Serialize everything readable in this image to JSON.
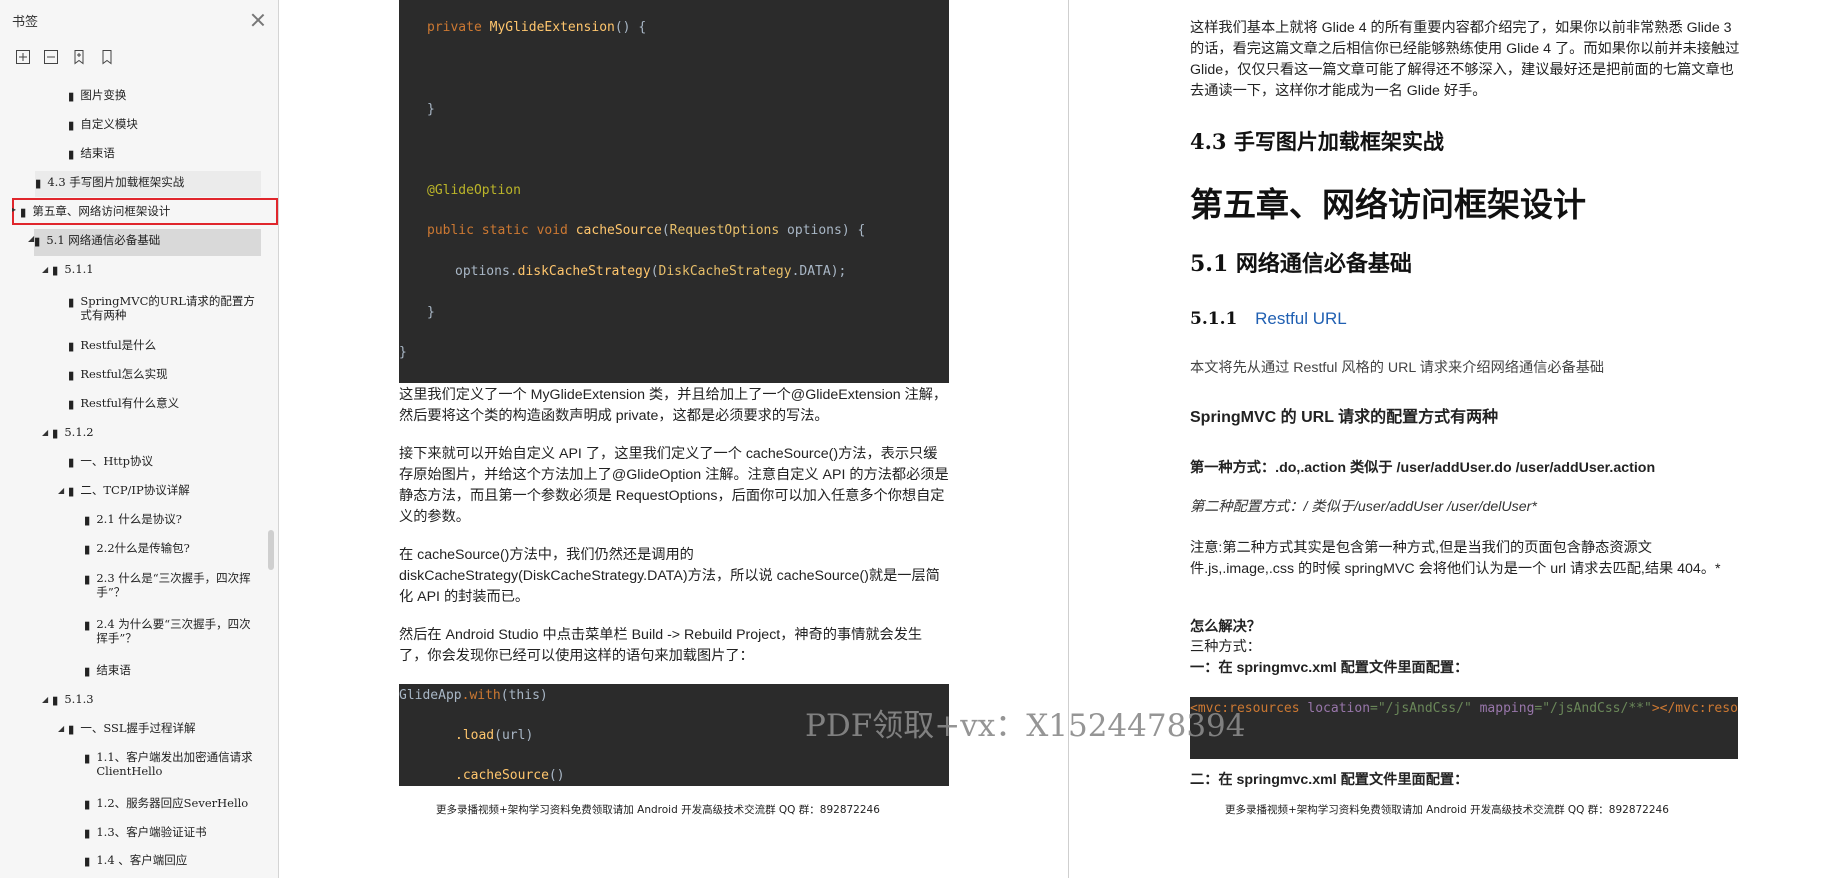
{
  "sidebar": {
    "title": "书签",
    "tools": [
      "expand-all-icon",
      "collapse-all-icon",
      "bookmark-add-icon",
      "bookmark-icon"
    ],
    "items": [
      {
        "label": "图片变换"
      },
      {
        "label": "自定义模块"
      },
      {
        "label": "结束语"
      },
      {
        "label": "4.3 手写图片加载框架实战"
      },
      {
        "label": "第五章、网络访问框架设计"
      },
      {
        "label": "5.1 网络通信必备基础"
      },
      {
        "label": "5.1.1"
      },
      {
        "label": "SpringMVC的URL请求的配置方式有两种"
      },
      {
        "label": "Restful是什么"
      },
      {
        "label": "Restful怎么实现"
      },
      {
        "label": "Restful有什么意义"
      },
      {
        "label": "5.1.2"
      },
      {
        "label": "一、Http协议"
      },
      {
        "label": "二、TCP/IP协议详解"
      },
      {
        "label": "2.1 什么是协议?"
      },
      {
        "label": "2.2什么是传输包?"
      },
      {
        "label": "2.3 什么是“三次握手，四次挥手”？"
      },
      {
        "label": "2.4 为什么要“三次握手，四次挥手”？"
      },
      {
        "label": "结束语"
      },
      {
        "label": "5.1.3"
      },
      {
        "label": "一、SSL握手过程详解"
      },
      {
        "label": "1.1、客户端发出加密通信请求ClientHello"
      },
      {
        "label": "1.2、服务器回应SeverHello"
      },
      {
        "label": "1.3、客户端验证证书"
      },
      {
        "label": "1.4 、客户端回应"
      }
    ]
  },
  "left_page": {
    "code1": {
      "private_kw": "private",
      "ctor": "MyGlideExtension",
      "ctor_tail": "() {",
      "brace1": "}",
      "annotation": "@GlideOption",
      "public_kw": "public static void",
      "method": "cacheSource",
      "param_type": "RequestOptions",
      "param_tail": " options) {",
      "body_obj": "options.",
      "body_fn": "diskCacheStrategy",
      "body_cls": "DiskCacheStrategy",
      "body_tail": ".DATA);",
      "brace2": "}",
      "brace3": "}"
    },
    "p1": "这里我们定义了一个 MyGlideExtension 类，并且给加上了一个@GlideExtension 注解，然后要将这个类的构造函数声明成 private，这都是必须要求的写法。",
    "p2": "接下来就可以开始自定义 API 了，这里我们定义了一个 cacheSource()方法，表示只缓存原始图片，并给这个方法加上了@GlideOption 注解。注意自定义 API 的方法都必须是静态方法，而且第一个参数必须是 RequestOptions，后面你可以加入任意多个你想自定义的参数。",
    "p3": "在 cacheSource()方法中，我们仍然还是调用的 diskCacheStrategy(DiskCacheStrategy.DATA)方法，所以说 cacheSource()就是一层简化 API 的封装而已。",
    "p4": "然后在 Android Studio 中点击菜单栏 Build -> Rebuild Project，神奇的事情就会发生了，你会发现你已经可以使用这样的语句来加载图片了：",
    "code2": {
      "l1_cls": "GlideApp",
      "l1_fn": ".with",
      "l1_tail": "(this)",
      "l2_fn": ".load",
      "l2_tail": "(url)",
      "l3_fn": ".cacheSource",
      "l3_tail": "()"
    },
    "footer": "更多录播视频+架构学习资料免费领取请加 Android 开发高级技术交流群 QQ 群：892872246"
  },
  "right_page": {
    "p_top": "这样我们基本上就将 Glide 4 的所有重要内容都介绍完了，如果你以前非常熟悉 Glide 3 的话，看完这篇文章之后相信你已经能够熟练使用 Glide 4 了。而如果你以前并未接触过 Glide，仅仅只看这一篇文章可能了解得还不够深入，建议最好还是把前面的七篇文章也去通读一下，这样你才能成为一名 Glide 好手。",
    "h43": "4.3 手写图片加载框架实战",
    "h5": "第五章、网络访问框架设计",
    "h51": "5.1 网络通信必备基础",
    "h511_num": "5.1.1",
    "h511_title": "Restful URL",
    "intro": "本文将先从通过 Restful 风格的 URL 请求来介绍网络通信必备基础",
    "h_spring": "SpringMVC 的 URL 请求的配置方式有两种",
    "way1": "第一种方式：.do,.action  类似于  /user/addUser.do /user/addUser.action",
    "way2": "第二种配置方式：/  类似于/user/addUser /user/delUser*",
    "note": "注意:第二种方式其实是包含第一种方式,但是当我们的页面包含静态资源文件.js,.image,.css  的时候  springMVC  会将他们认为是一个  url  请求去匹配,结果 404。*",
    "how": "怎么解决？",
    "three": "三种方式：",
    "one": "一：在 springmvc.xml 配置文件里面配置：",
    "xml_tag": "<mvc:resources",
    "xml_attr1": " location",
    "xml_val1": "=\"/jsAndCss/\"",
    "xml_attr2": " mapping",
    "xml_val2": "=\"/jsAndCss/**\"",
    "xml_end": "></mvc:resour",
    "two": "二：在 springmvc.xml 配置文件里面配置：",
    "footer": "更多录播视频+架构学习资料免费领取请加 Android 开发高级技术交流群 QQ 群：892872246"
  },
  "watermark": "PDF领取+vx：X1524478394",
  "colors": {
    "accent_red": "#e0262c",
    "code_bg": "#2b2b2b",
    "link_blue": "#1f5fb2"
  }
}
